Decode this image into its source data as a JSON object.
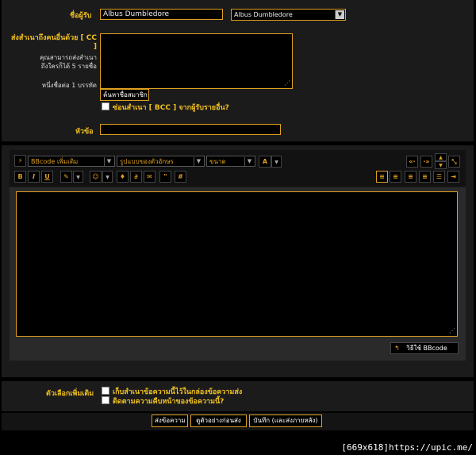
{
  "recipient": {
    "label": "ชื่อผู้รับ",
    "value": "Albus Dumbledore",
    "dropdown_value": "Albus Dumbledore"
  },
  "cc": {
    "label": "ส่งสำเนาถึงคนอื่นด้วย [ CC ]",
    "note1": "คุณสามารถส่งสำเนาถึงใครก็ได้ 5 รายชื่อ",
    "note2": "หนึ่งชื่อต่อ 1 บรรทัด",
    "find_member_button": "ค้นหาชื่อสมาชิก",
    "bcc_label": "ซ่อนสำเนา [ BCC ] จากผู้รับรายอื่น?"
  },
  "subject": {
    "label": "หัวข้อ",
    "value": ""
  },
  "editor": {
    "mode_select": "BBcode เพิ่มเติม",
    "font_select": "รูปแบบของตัวอักษร",
    "size_select": "ขนาด",
    "nav_left": "«·",
    "nav_right": "·»",
    "toolbar_bold": "B",
    "toolbar_italic": "I",
    "toolbar_underline": "U",
    "toolbar_color": "A",
    "toolbar_hash": "#",
    "toolbar_quote": "\"",
    "bbcode_help": "วิธีใช้ BBcode"
  },
  "options": {
    "label": "ตัวเลือกเพิ่มเติม",
    "save_copy": "เก็บสำเนาข้อความนี้ไว้ในกล่องข้อความส่ง",
    "track_read": "ติดตามความคืบหน้าของข้อความนี้?"
  },
  "buttons": {
    "send": "ส่งข้อความ",
    "preview": "ดูตัวอย่างก่อนส่ง",
    "save": "บันทึก (และส่งภายหลัง)"
  },
  "watermark": "[669x618]https://upic.me/",
  "colors": {
    "accent": "#e0a020",
    "label": "#f0c020",
    "panel": "#1b1b1b"
  }
}
